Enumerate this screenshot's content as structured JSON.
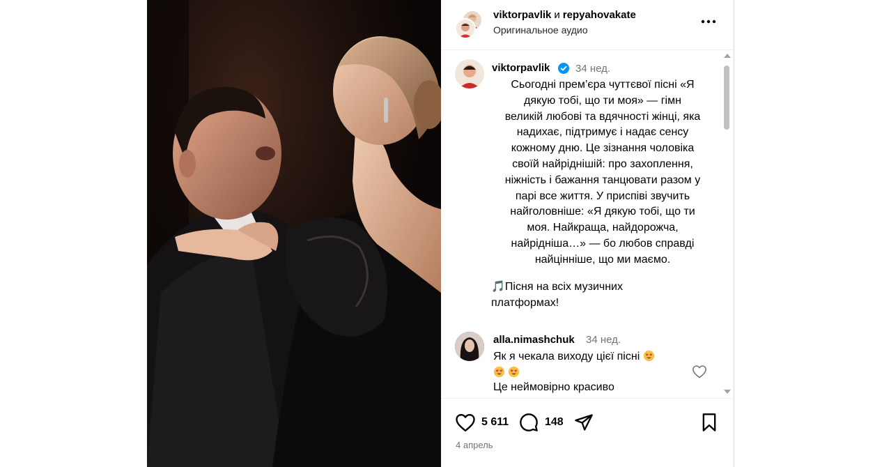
{
  "post": {
    "image_alt": "photo"
  },
  "header": {
    "user1": "viktorpavlik",
    "conj": "и",
    "user2": "repyahovakate",
    "audio": "Оригинальное аудио",
    "more_icon": "more-horizontal-icon"
  },
  "caption": {
    "username": "viktorpavlik",
    "verified_icon": "verified-badge-icon",
    "time": "34 нед.",
    "text": "Сьогодні прем’єра чуттєвої пісні «Я\nдякую тобі, що ти моя» — гімн\nвеликій любові та вдячності жінці, яка\nнадихає, підтримує і надає сенсу\nкожному дню. Це зізнання чоловіка\nсвоїй найріднішій: про захоплення,\nніжність і бажання танцювати разом у\nпарі все життя. У приспіві звучить\nнайголовніше: «Я дякую тобі, що ти\nмоя. Найкраща, найдорожча,\nнайрідніша…» — бо любов справді\nнайцінніше, що ми маємо.",
    "music_note": "🎵",
    "music_text": "Пісня на всіх музичних\nплатформах!"
  },
  "comment": {
    "username": "alla.nimashchuk",
    "time": "34 нед.",
    "text": "Як я чекала виходу цієї пісні",
    "text2": "Це неймовірно красиво",
    "emoji_icon": "heart-eyes-emoji-icon",
    "like_icon": "heart-outline-icon"
  },
  "actions": {
    "likes": "5 611",
    "comments": "148",
    "like_icon": "heart-outline-icon",
    "comment_icon": "comment-bubble-icon",
    "share_icon": "paper-plane-icon",
    "save_icon": "bookmark-icon",
    "date": "4 апрель"
  },
  "colors": {
    "verified": "#0095f6",
    "muted": "#737373",
    "emoji": "#f7c144",
    "emoji_heart": "#e8384f"
  }
}
